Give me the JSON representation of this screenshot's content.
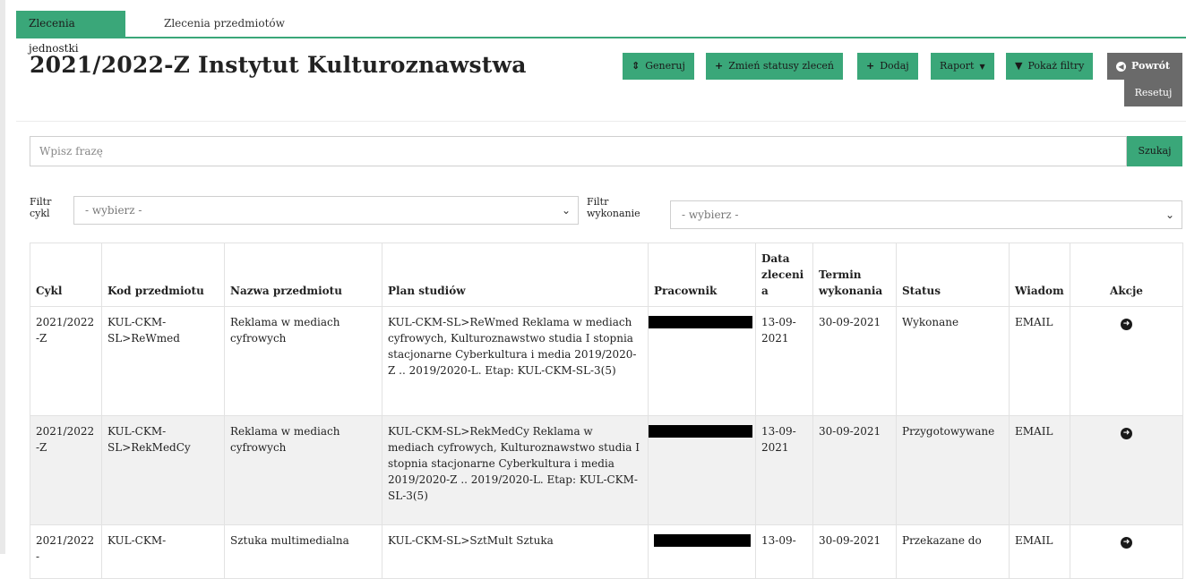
{
  "tabs": [
    {
      "label": "Zlecenia jednostki",
      "active": true
    },
    {
      "label": "Zlecenia przedmiotów",
      "active": false
    }
  ],
  "page_title": "2021/2022-Z Instytut Kulturoznawstwa",
  "toolbar": {
    "generate": "Generuj",
    "change_status": "Zmień statusy zleceń",
    "add": "Dodaj",
    "report": "Raport",
    "show_filters": "Pokaż filtry",
    "back": "Powrót",
    "reset": "Resetuj"
  },
  "search": {
    "placeholder": "Wpisz frazę",
    "button": "Szukaj"
  },
  "filters": {
    "cycle_label": "Filtr cykl",
    "cycle_value": "- wybierz -",
    "execution_label": "Filtr wykonanie",
    "execution_value": "- wybierz -"
  },
  "table": {
    "headers": [
      "Cykl",
      "Kod przedmiotu",
      "Nazwa przedmiotu",
      "Plan studiów",
      "Pracownik",
      "Data zlecenia",
      "Termin wykonania",
      "Status",
      "Wiadom",
      "Akcje"
    ],
    "rows": [
      {
        "cykl": "2021/2022-Z",
        "kod": "KUL-CKM-SL>ReWmed",
        "nazwa": "Reklama w mediach cyfrowych",
        "plan": "KUL-CKM-SL>ReWmed Reklama w mediach cyfrowych, Kulturoznawstwo studia I stopnia stacjonarne Cyberkultura i media 2019/2020-Z .. 2019/2020-L. Etap: KUL-CKM-SL-3(5)",
        "data": "13-09-2021",
        "termin": "30-09-2021",
        "status": "Wykonane",
        "wiadom": "EMAIL"
      },
      {
        "cykl": "2021/2022-Z",
        "kod": "KUL-CKM-SL>RekMedCy",
        "nazwa": "Reklama w mediach cyfrowych",
        "plan": "KUL-CKM-SL>RekMedCy Reklama w mediach cyfrowych, Kulturoznawstwo studia I stopnia stacjonarne Cyberkultura i media 2019/2020-Z .. 2019/2020-L. Etap: KUL-CKM-SL-3(5)",
        "data": "13-09-2021",
        "termin": "30-09-2021",
        "status": "Przygotowywane",
        "wiadom": "EMAIL"
      },
      {
        "cykl": "2021/2022-",
        "kod": "KUL-CKM-",
        "nazwa": "Sztuka multimedialna",
        "plan": "KUL-CKM-SL>SztMult Sztuka",
        "data": "13-09-",
        "termin": "30-09-2021",
        "status": "Przekazane do",
        "wiadom": "EMAIL"
      }
    ]
  },
  "colors": {
    "accent": "#3aa779",
    "gray_button": "#6a6a6a",
    "alt_row": "#f1f1f1"
  }
}
